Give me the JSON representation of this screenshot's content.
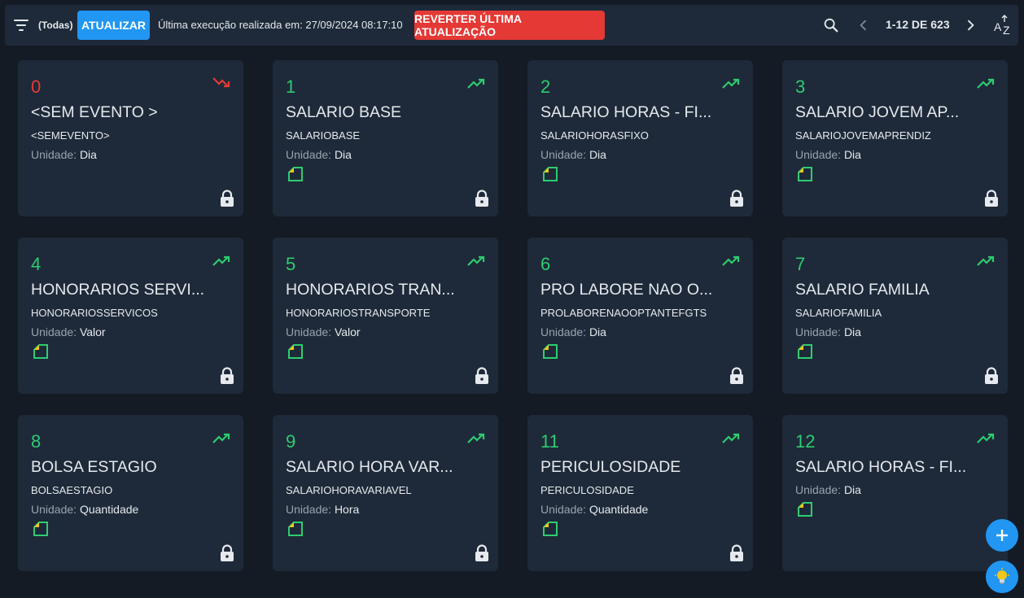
{
  "toolbar": {
    "filter_label": "(Todas)",
    "update_label": "ATUALIZAR",
    "last_run": "Última execução realizada em: 27/09/2024 08:17:10",
    "revert_label": "REVERTER ÚLTIMA ATUALIZAÇÃO",
    "pagination": "1-12 DE 623"
  },
  "colors": {
    "accent": "#2196f3",
    "danger": "#e53935",
    "positive": "#2ecc71",
    "card_bg": "#1e2a39",
    "page_bg": "#141b24"
  },
  "unit_label": "Unidade:",
  "cards": [
    {
      "code": "0",
      "title": "<SEM EVENTO >",
      "ident": "<SEMEVENTO>",
      "unit": "Dia",
      "trend": "trending-down-icon",
      "doc": false,
      "lock": true
    },
    {
      "code": "1",
      "title": "SALARIO BASE",
      "ident": "SALARIOBASE",
      "unit": "Dia",
      "trend": "trending-up-icon",
      "doc": true,
      "lock": true
    },
    {
      "code": "2",
      "title": "SALARIO HORAS - FI...",
      "ident": "SALARIOHORASFIXO",
      "unit": "Dia",
      "trend": "trending-up-icon",
      "doc": true,
      "lock": true
    },
    {
      "code": "3",
      "title": "SALARIO JOVEM AP...",
      "ident": "SALARIOJOVEMAPRENDIZ",
      "unit": "Dia",
      "trend": "trending-up-icon",
      "doc": true,
      "lock": true
    },
    {
      "code": "4",
      "title": "HONORARIOS SERVI...",
      "ident": "HONORARIOSSERVICOS",
      "unit": "Valor",
      "trend": "trending-up-icon",
      "doc": true,
      "lock": true
    },
    {
      "code": "5",
      "title": "HONORARIOS TRAN...",
      "ident": "HONORARIOSTRANSPORTE",
      "unit": "Valor",
      "trend": "trending-up-icon",
      "doc": true,
      "lock": true
    },
    {
      "code": "6",
      "title": "PRO LABORE NAO O...",
      "ident": "PROLABORENAOOPTANTEFGTS",
      "unit": "Dia",
      "trend": "trending-up-icon",
      "doc": true,
      "lock": true
    },
    {
      "code": "7",
      "title": "SALARIO FAMILIA",
      "ident": "SALARIOFAMILIA",
      "unit": "Dia",
      "trend": "trending-up-icon",
      "doc": true,
      "lock": true
    },
    {
      "code": "8",
      "title": "BOLSA ESTAGIO",
      "ident": "BOLSAESTAGIO",
      "unit": "Quantidade",
      "trend": "trending-up-icon",
      "doc": true,
      "lock": true
    },
    {
      "code": "9",
      "title": "SALARIO HORA VAR...",
      "ident": "SALARIOHORAVARIAVEL",
      "unit": "Hora",
      "trend": "trending-up-icon",
      "doc": true,
      "lock": true
    },
    {
      "code": "11",
      "title": "PERICULOSIDADE",
      "ident": "PERICULOSIDADE",
      "unit": "Quantidade",
      "trend": "trending-up-icon",
      "doc": true,
      "lock": true
    },
    {
      "code": "12",
      "title": "SALARIO HORAS - FI...",
      "ident": "",
      "unit": "Dia",
      "trend": "trending-up-icon",
      "doc": true,
      "lock": false
    }
  ]
}
